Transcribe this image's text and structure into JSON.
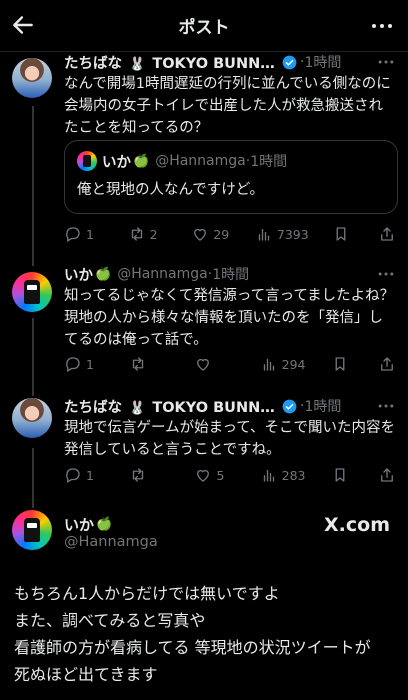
{
  "header": {
    "title": "ポスト"
  },
  "tweets": [
    {
      "name": "たちばな",
      "name_suffix": "TOKYO BUNNYS C...",
      "emoji": "🐰",
      "time": "1時間",
      "text": "なんで開場1時間遅延の行列に並んでいる側なのに会場内の女子トイレで出産した人が救急搬送されたことを知ってるの？",
      "quote": {
        "name": "いか",
        "emoji": "🍏",
        "handle": "@Hannamga",
        "time": "1時間",
        "text": "俺と現地の人なんですけど。"
      },
      "replies": "1",
      "retweets": "2",
      "likes": "29",
      "views": "7393"
    },
    {
      "name": "いか",
      "emoji": "🍏",
      "handle": "@Hannamga",
      "time": "1時間",
      "text": "知ってるじゃなくて発信源って言ってましたよね？現地の人から様々な情報を頂いたのを「発信」してるのは俺って話で。",
      "replies": "1",
      "retweets": "",
      "likes": "",
      "views": "294"
    },
    {
      "name": "たちばな",
      "name_suffix": "TOKYO BUNNYS C...",
      "emoji": "🐰",
      "time": "1時間",
      "text": "現地で伝言ゲームが始まって、そこで聞いた内容を発信していると言うことですね。",
      "replies": "1",
      "retweets": "",
      "likes": "5",
      "views": "283"
    }
  ],
  "main": {
    "name": "いか",
    "emoji": "🍏",
    "handle": "@Hannamga",
    "brand": "X.com",
    "lines": [
      "もちろん1人からだけでは無いですよ",
      "また、調べてみると写真や",
      "看護師の方が看病してる 等現地の状況ツイートが",
      "死ぬほど出てきます"
    ]
  },
  "colors": {
    "background": "#000000",
    "text": "#e7e9ea",
    "muted": "#71767b",
    "verified": "#1d9bf0",
    "border": "#333639"
  }
}
